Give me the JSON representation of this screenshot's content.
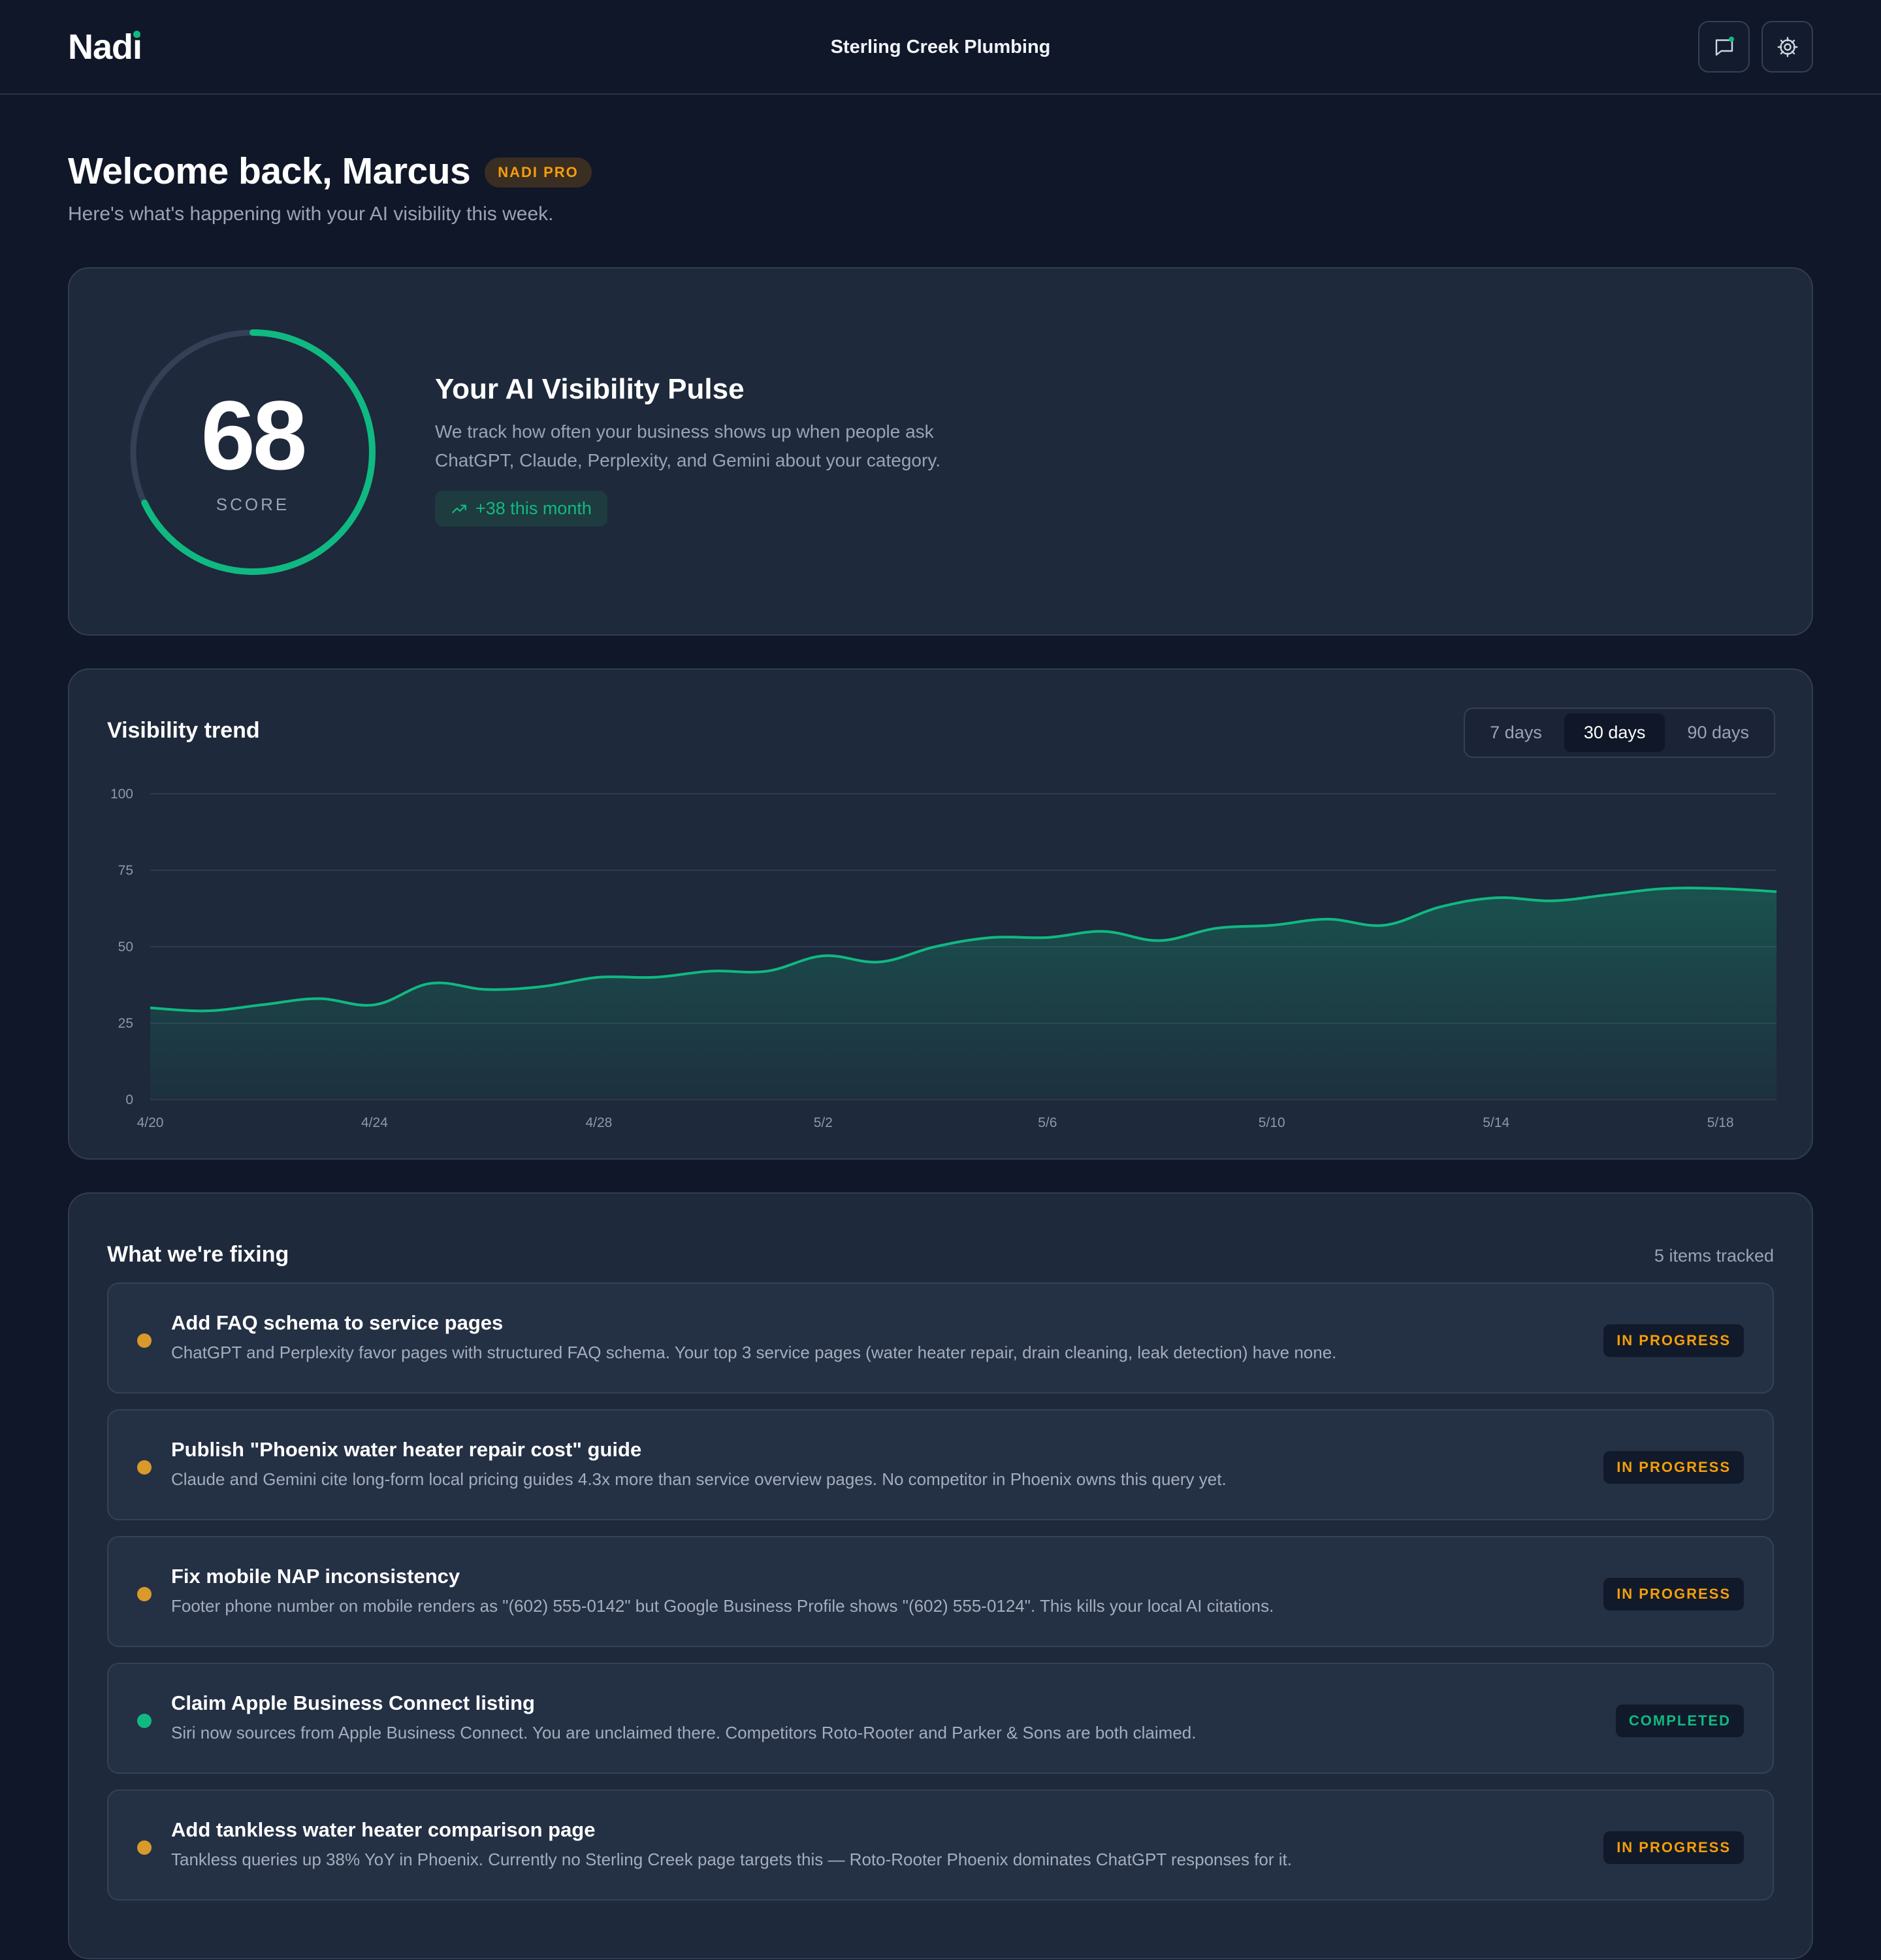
{
  "header": {
    "logo": "Nadi",
    "business_name": "Sterling Creek Plumbing"
  },
  "welcome": {
    "title": "Welcome back, Marcus",
    "badge": "NADI PRO",
    "subtitle": "Here's what's happening with your AI visibility this week."
  },
  "pulse": {
    "score": "68",
    "score_value": 68,
    "score_label": "SCORE",
    "title": "Your AI Visibility Pulse",
    "description_line1": "We track how often your business shows up when people ask",
    "description_line2": "ChatGPT, Claude, Perplexity, and Gemini about your category.",
    "change": "+38 this month"
  },
  "trend": {
    "title": "Visibility trend",
    "ranges": [
      "7 days",
      "30 days",
      "90 days"
    ],
    "active_range": "30 days"
  },
  "chart_data": {
    "type": "area",
    "title": "",
    "xlabel": "",
    "ylabel": "",
    "ylim": [
      0,
      100
    ],
    "y_ticks": [
      "100",
      "75",
      "50",
      "25",
      "0"
    ],
    "x_tick_labels": [
      "4/20",
      "4/24",
      "4/28",
      "5/2",
      "5/6",
      "5/10",
      "5/14",
      "5/18"
    ],
    "x": [
      "4/20",
      "4/21",
      "4/22",
      "4/23",
      "4/24",
      "4/25",
      "4/26",
      "4/27",
      "4/28",
      "4/29",
      "4/30",
      "5/1",
      "5/2",
      "5/3",
      "5/4",
      "5/5",
      "5/6",
      "5/7",
      "5/8",
      "5/9",
      "5/10",
      "5/11",
      "5/12",
      "5/13",
      "5/14",
      "5/15",
      "5/16",
      "5/17",
      "5/18",
      "5/19"
    ],
    "series": [
      {
        "values": [
          30,
          29,
          31,
          33,
          31,
          38,
          36,
          37,
          40,
          40,
          42,
          42,
          47,
          45,
          50,
          53,
          53,
          55,
          52,
          56,
          57,
          59,
          57,
          63,
          66,
          65,
          67,
          69,
          69,
          68
        ]
      }
    ],
    "grid": true,
    "color": "#10b981"
  },
  "fixing": {
    "title": "What we're fixing",
    "count": "5 items tracked",
    "items": [
      {
        "title": "Add FAQ schema to service pages",
        "description": "ChatGPT and Perplexity favor pages with structured FAQ schema. Your top 3 service pages (water heater repair, drain cleaning, leak detection) have none.",
        "status": "IN PROGRESS",
        "color": "#d99a2b"
      },
      {
        "title": "Publish \"Phoenix water heater repair cost\" guide",
        "description": "Claude and Gemini cite long-form local pricing guides 4.3x more than service overview pages. No competitor in Phoenix owns this query yet.",
        "status": "IN PROGRESS",
        "color": "#d99a2b"
      },
      {
        "title": "Fix mobile NAP inconsistency",
        "description": "Footer phone number on mobile renders as \"(602) 555-0142\" but Google Business Profile shows \"(602) 555-0124\". This kills your local AI citations.",
        "status": "IN PROGRESS",
        "color": "#d99a2b"
      },
      {
        "title": "Claim Apple Business Connect listing",
        "description": "Siri now sources from Apple Business Connect. You are unclaimed there. Competitors Roto-Rooter and Parker & Sons are both claimed.",
        "status": "COMPLETED",
        "color": "#10b981"
      },
      {
        "title": "Add tankless water heater comparison page",
        "description": "Tankless queries up 38% YoY in Phoenix. Currently no Sterling Creek page targets this — Roto-Rooter Phoenix dominates ChatGPT responses for it.",
        "status": "IN PROGRESS",
        "color": "#d99a2b"
      }
    ]
  },
  "colors": {
    "accent": "#10b981",
    "warning": "#f59e0b",
    "background": "#0f1728",
    "card": "#1e293b"
  }
}
